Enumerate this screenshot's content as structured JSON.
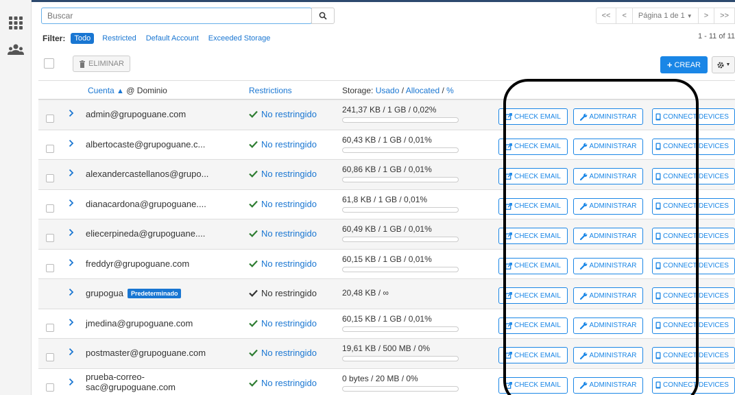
{
  "search": {
    "placeholder": "Buscar"
  },
  "pagination": {
    "first": "<<",
    "prev": "<",
    "page_label": "Página 1 de 1",
    "next": ">",
    "last": ">>",
    "count": "1 - 11 of 11"
  },
  "filter": {
    "label": "Filter:",
    "options": [
      "Todo",
      "Restricted",
      "Default Account",
      "Exceeded Storage"
    ],
    "active": "Todo"
  },
  "toolbar": {
    "delete_label": "ELIMINAR",
    "create_label": "CREAR"
  },
  "columns": {
    "account": "Cuenta",
    "domain": "@ Dominio",
    "restrictions": "Restrictions",
    "storage_prefix": "Storage:",
    "storage_used": "Usado",
    "storage_allocated": "Allocated",
    "storage_pct": "%"
  },
  "actions": {
    "check_email": "CHECK EMAIL",
    "administrar": "ADMINISTRAR",
    "connect_devices": "CONNECT DEVICES"
  },
  "rows": [
    {
      "account": "admin@grupoguane.com",
      "restriction": "No restringido",
      "storage": "241,37 KB / 1 GB / 0,02%",
      "fill": 0.0002
    },
    {
      "account": "albertocaste@grupoguane.c...",
      "restriction": "No restringido",
      "storage": "60,43 KB / 1 GB / 0,01%",
      "fill": 0.0001
    },
    {
      "account": "alexandercastellanos@grupo...",
      "restriction": "No restringido",
      "storage": "60,86 KB / 1 GB / 0,01%",
      "fill": 0.0001
    },
    {
      "account": "dianacardona@grupoguane....",
      "restriction": "No restringido",
      "storage": "61,8 KB / 1 GB / 0,01%",
      "fill": 0.0001
    },
    {
      "account": "eliecerpineda@grupoguane....",
      "restriction": "No restringido",
      "storage": "60,49 KB / 1 GB / 0,01%",
      "fill": 0.0001
    },
    {
      "account": "freddyr@grupoguane.com",
      "restriction": "No restringido",
      "storage": "60,15 KB / 1 GB / 0,01%",
      "fill": 0.0001
    },
    {
      "account": "grupogua",
      "badge": "Predeterminado",
      "restriction": "No restringido",
      "storage": "20,48 KB / ∞"
    },
    {
      "account": "jmedina@grupoguane.com",
      "restriction": "No restringido",
      "storage": "60,15 KB / 1 GB / 0,01%",
      "fill": 0.0001
    },
    {
      "account": "postmaster@grupoguane.com",
      "restriction": "No restringido",
      "storage": "19,61 KB / 500 MB / 0%",
      "fill": 0
    },
    {
      "account": "prueba-correo-sac@grupoguane.com",
      "restriction": "No restringido",
      "storage": "0 bytes / 20 MB / 0%",
      "fill": 0
    }
  ],
  "colors": {
    "accent": "#1976d2",
    "button": "#1a86e6",
    "header_bar": "#2d4a6e"
  }
}
